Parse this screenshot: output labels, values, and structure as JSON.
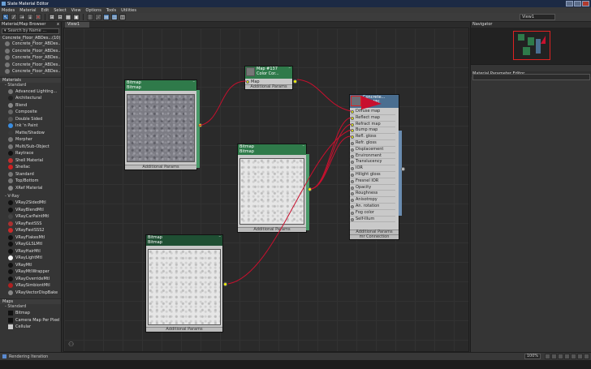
{
  "window": {
    "title": "Slate Material Editor"
  },
  "menu": [
    "Modes",
    "Material",
    "Edit",
    "Select",
    "View",
    "Options",
    "Tools",
    "Utilities"
  ],
  "toolbar": {
    "view_selector": "View1"
  },
  "browser": {
    "title": "Material/Map Browser",
    "search_placeholder": "Search by Name ...",
    "scene_group": "Concrete_Floor_ABDes...",
    "scene_group_count": "(10)",
    "scene_items": [
      "Concrete_Floor_ABDes...",
      "Concrete_Floor_ABDes...",
      "Concrete_Floor_ABDes...",
      "Concrete_Floor_ABDes...",
      "Concrete_Floor_ABDes..."
    ],
    "materials_label": "Materials",
    "standard_label": "Standard",
    "standard_items": [
      {
        "label": "Advanced Lighting...",
        "color": "#777777"
      },
      {
        "label": "Architectural",
        "color": "#222222"
      },
      {
        "label": "Blend",
        "color": "#888888"
      },
      {
        "label": "Composite",
        "color": "#666666"
      },
      {
        "label": "Double Sided",
        "color": "#555555"
      },
      {
        "label": "Ink 'n Paint",
        "color": "#3a8de0"
      },
      {
        "label": "Matte/Shadow",
        "color": "#3a3a3a"
      },
      {
        "label": "Morpher",
        "color": "#777777"
      },
      {
        "label": "Multi/Sub-Object",
        "color": "#777777"
      },
      {
        "label": "Raytrace",
        "color": "#111111"
      },
      {
        "label": "Shell Material",
        "color": "#c03030"
      },
      {
        "label": "Shellac",
        "color": "#cc2020"
      },
      {
        "label": "Standard",
        "color": "#777777"
      },
      {
        "label": "Top/Bottom",
        "color": "#777777"
      },
      {
        "label": "XRef Material",
        "color": "#888888"
      }
    ],
    "vray_label": "V-Ray",
    "vray_items": [
      {
        "label": "VRay2SidedMtl",
        "color": "#111111"
      },
      {
        "label": "VRayBlendMtl",
        "color": "#111111"
      },
      {
        "label": "VRayCarPaintMtl",
        "color": "#444444"
      },
      {
        "label": "VRayFastSSS",
        "color": "#aa3030"
      },
      {
        "label": "VRayFastSSS2",
        "color": "#cc2a2a"
      },
      {
        "label": "VRayFlakesMtl",
        "color": "#111111"
      },
      {
        "label": "VRayGLSLMtl",
        "color": "#111111"
      },
      {
        "label": "VRayHairMtl",
        "color": "#111111"
      },
      {
        "label": "VRayLightMtl",
        "color": "#f4f4f4"
      },
      {
        "label": "VRayMtl",
        "color": "#111111"
      },
      {
        "label": "VRayMtlWrapper",
        "color": "#111111"
      },
      {
        "label": "VRayOverrideMtl",
        "color": "#111111"
      },
      {
        "label": "VRaySimbiontMtl",
        "color": "#b02020"
      },
      {
        "label": "VRayVectorDispBake",
        "color": "#888888"
      }
    ],
    "maps_label": "Maps",
    "maps_standard_label": "Standard",
    "maps_items": [
      {
        "label": "Bitmap",
        "color": "#111111"
      },
      {
        "label": "Camera Map Per Pixel",
        "color": "#111111"
      },
      {
        "label": "Cellular",
        "color": "#cccccc"
      }
    ]
  },
  "view_tab": "View1",
  "nodes": {
    "bitmap1": {
      "id": "Bitmap",
      "type": "Bitmap",
      "name": "Additional Params"
    },
    "bitmap2": {
      "id": "Bitmap",
      "type": "Bitmap",
      "name": "Additional Params"
    },
    "bitmap3": {
      "id": "Bitmap",
      "type": "Bitmap",
      "name": "Additional Params"
    },
    "colorcor": {
      "id": "Map #137",
      "type": "Color Cor...",
      "slot": "Map",
      "name": "Additional Params"
    },
    "vraymtl": {
      "title1": "Concrete...",
      "title2": "VRayMtl",
      "slots": [
        "Diffuse map",
        "Reflect map",
        "Refract map",
        "Bump map",
        "Refl. gloss",
        "Refr. gloss",
        "Displacement",
        "Environment",
        "Translucency",
        "IOR",
        "Hilight gloss",
        "Fresnel IOR",
        "Opacity",
        "Roughness",
        "Anisotropy",
        "An. rotation",
        "Fog color",
        "Self-Illum"
      ],
      "slot_active": [
        true,
        true,
        true,
        true,
        true,
        false,
        false,
        false,
        false,
        false,
        false,
        false,
        false,
        false,
        false,
        false,
        false,
        false
      ],
      "footer1": "Additional Params",
      "footer2": "mr Connection"
    }
  },
  "navigator": {
    "title": "Navigator"
  },
  "mpe": {
    "title": "Material Parameter Editor"
  },
  "status": {
    "text": "Rendering Iteration",
    "zoom": "100%"
  },
  "colors": {
    "node_green": "#2f7a4a",
    "vray_blue": "#4a6e90",
    "wire": "#c8102e",
    "port": "#f2f200"
  }
}
